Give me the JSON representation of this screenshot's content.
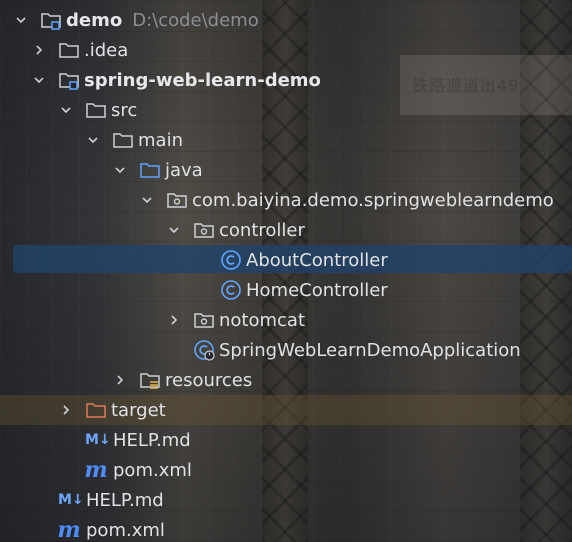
{
  "tree": {
    "root": {
      "label": "demo",
      "path": "D:\\code\\demo"
    },
    "idea": {
      "label": ".idea"
    },
    "module": {
      "label": "spring-web-learn-demo"
    },
    "src": {
      "label": "src"
    },
    "main": {
      "label": "main"
    },
    "java": {
      "label": "java"
    },
    "package": {
      "label": "com.baiyina.demo.springweblearndemo"
    },
    "controller": {
      "label": "controller"
    },
    "about_controller": {
      "label": "AboutController"
    },
    "home_controller": {
      "label": "HomeController"
    },
    "notomcat": {
      "label": "notomcat"
    },
    "application": {
      "label": "SpringWebLearnDemoApplication"
    },
    "resources": {
      "label": "resources"
    },
    "target": {
      "label": "target"
    },
    "module_help": {
      "label": "HELP.md",
      "badge": "M↓"
    },
    "module_pom": {
      "label": "pom.xml",
      "badge": "m"
    },
    "root_help": {
      "label": "HELP.md",
      "badge": "M↓"
    },
    "root_pom": {
      "label": "pom.xml",
      "badge": "m"
    }
  },
  "background_sign": "铁路道道出49",
  "colors": {
    "selection": "#20426b",
    "folder_outline": "#ced0d6",
    "source_folder": "#5ea4ff",
    "excluded_folder": "#e0785a",
    "class_icon": "#5ea4ff",
    "maven_icon": "#4e8cff",
    "text": "#dfe1e5",
    "path_text": "#8b8e94"
  },
  "icons": {
    "expanded": "chevron-down-icon",
    "collapsed": "chevron-right-icon",
    "folder": "folder-icon",
    "module": "module-folder-icon",
    "source_root": "source-folder-icon",
    "package": "package-icon",
    "class": "class-icon",
    "spring_app": "spring-boot-class-icon",
    "resources": "resources-folder-icon",
    "excluded": "excluded-folder-icon",
    "markdown": "markdown-icon",
    "maven": "maven-icon"
  }
}
